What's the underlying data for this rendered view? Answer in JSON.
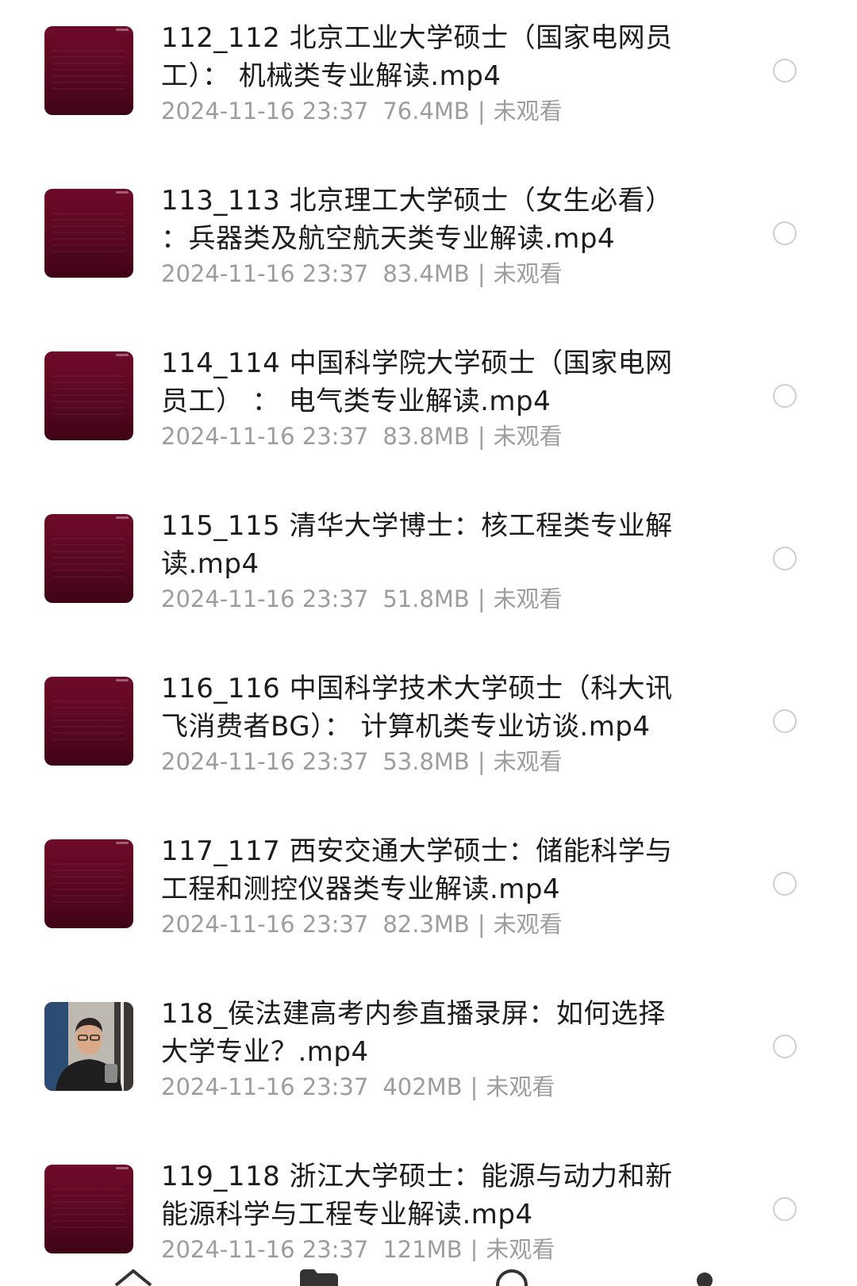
{
  "files": [
    {
      "title": "112_112 北京工业大学硕士（国家电网员\n工）： 机械类专业解读.mp4",
      "date": "2024-11-16 23:37",
      "size": "76.4MB",
      "status": "未观看",
      "thumb": "maroon"
    },
    {
      "title": "113_113 北京理工大学硕士（女生必看）\n：兵器类及航空航天类专业解读.mp4",
      "date": "2024-11-16 23:37",
      "size": "83.4MB",
      "status": "未观看",
      "thumb": "maroon"
    },
    {
      "title": "114_114 中国科学院大学硕士（国家电网\n员工） ： 电气类专业解读.mp4",
      "date": "2024-11-16 23:37",
      "size": "83.8MB",
      "status": "未观看",
      "thumb": "maroon"
    },
    {
      "title": "115_115 清华大学博士：核工程类专业解\n读.mp4",
      "date": "2024-11-16 23:37",
      "size": "51.8MB",
      "status": "未观看",
      "thumb": "maroon"
    },
    {
      "title": "116_116 中国科学技术大学硕士（科大讯\n飞消费者BG）： 计算机类专业访谈.mp4",
      "date": "2024-11-16 23:37",
      "size": "53.8MB",
      "status": "未观看",
      "thumb": "maroon"
    },
    {
      "title": "117_117 西安交通大学硕士：储能科学与\n工程和测控仪器类专业解读.mp4",
      "date": "2024-11-16 23:37",
      "size": "82.3MB",
      "status": "未观看",
      "thumb": "maroon"
    },
    {
      "title": "118_侯法建高考内参直播录屏：如何选择\n大学专业？.mp4",
      "date": "2024-11-16 23:37",
      "size": "402MB",
      "status": "未观看",
      "thumb": "person"
    },
    {
      "title": "119_118 浙江大学硕士：能源与动力和新\n能源科学与工程专业解读.mp4",
      "date": "2024-11-16 23:37",
      "size": "121MB",
      "status": "未观看",
      "thumb": "maroon"
    }
  ],
  "bottom_nav": {
    "icons": [
      "home-icon",
      "folder-icon",
      "search-icon",
      "profile-icon"
    ],
    "icon_color": "#333333"
  },
  "colors": {
    "title": "#1c1c1c",
    "meta": "#9d9d9d",
    "radio": "#cfcfcf",
    "thumb_maroon": "#6e0a2a"
  }
}
